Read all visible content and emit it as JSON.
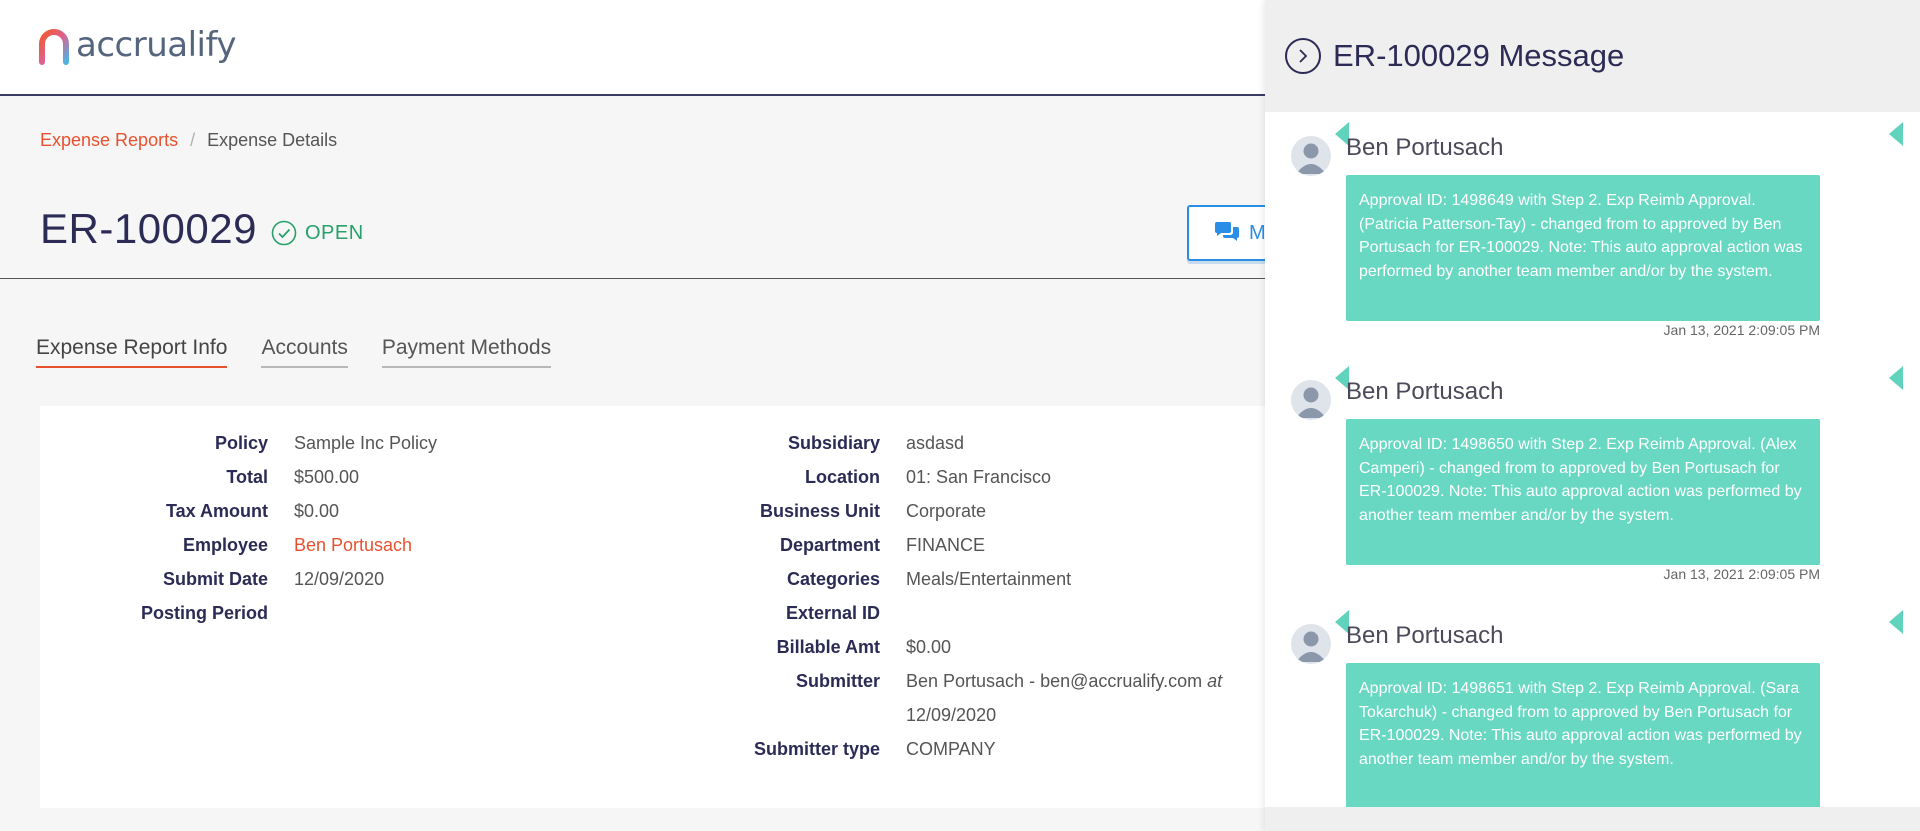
{
  "header": {
    "logo_text": "accrualify"
  },
  "breadcrumb": {
    "link": "Expense Reports",
    "separator": "/",
    "current": "Expense Details"
  },
  "report": {
    "id": "ER-100029",
    "status": "OPEN"
  },
  "messages_button": {
    "label": "Me"
  },
  "tabs": [
    {
      "label": "Expense Report Info",
      "active": true
    },
    {
      "label": "Accounts",
      "active": false
    },
    {
      "label": "Payment Methods",
      "active": false
    }
  ],
  "details": {
    "left": [
      {
        "label": "Policy",
        "value": "Sample Inc Policy"
      },
      {
        "label": "Total",
        "value": "$500.00"
      },
      {
        "label": "Tax Amount",
        "value": "$0.00"
      },
      {
        "label": "Employee",
        "value": "Ben Portusach"
      },
      {
        "label": "Submit Date",
        "value": "12/09/2020"
      },
      {
        "label": "Posting Period",
        "value": ""
      }
    ],
    "right": [
      {
        "label": "Subsidiary",
        "value": "asdasd"
      },
      {
        "label": "Location",
        "value": "01: San Francisco"
      },
      {
        "label": "Business Unit",
        "value": "Corporate"
      },
      {
        "label": "Department",
        "value": "FINANCE"
      },
      {
        "label": "Categories",
        "value": "Meals/Entertainment"
      },
      {
        "label": "External ID",
        "value": ""
      },
      {
        "label": "Billable Amt",
        "value": "$0.00"
      },
      {
        "label": "Submitter",
        "value": "Ben Portusach - ben@accrualify.com",
        "value_suffix": "at",
        "value_line2": "12/09/2020"
      },
      {
        "label": "Submitter type",
        "value": "COMPANY"
      }
    ]
  },
  "panel": {
    "title": "ER-100029 Message",
    "messages": [
      {
        "author": "Ben Portusach",
        "text": "Approval ID: 1498649 with Step 2. Exp Reimb Approval. (Patricia Patterson-Tay) - changed from to approved by Ben Portusach for ER-100029. Note: This auto approval action was performed by another team member and/or by the system.",
        "time": "Jan 13, 2021 2:09:05 PM"
      },
      {
        "author": "Ben Portusach",
        "text": "Approval ID: 1498650 with Step 2. Exp Reimb Approval. (Alex Camperi) - changed from to approved by Ben Portusach for ER-100029. Note: This auto approval action was performed by another team member and/or by the system.",
        "time": "Jan 13, 2021 2:09:05 PM"
      },
      {
        "author": "Ben Portusach",
        "text": "Approval ID: 1498651 with Step 2. Exp Reimb Approval. (Sara Tokarchuk) - changed from to approved by Ben Portusach for ER-100029. Note: This auto approval action was performed by another team member and/or by the system.",
        "time": ""
      }
    ]
  },
  "colors": {
    "accent": "#e8512e",
    "navy": "#2c2b55",
    "status_green": "#28a06a",
    "message_bubble": "#68d8c2",
    "button_blue": "#2b8ee6"
  }
}
